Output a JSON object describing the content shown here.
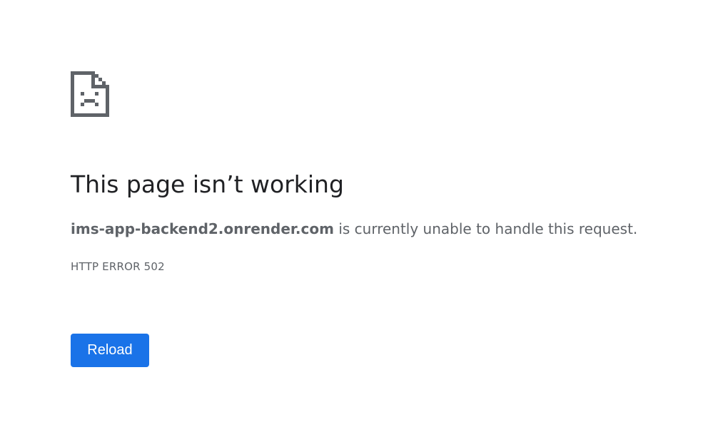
{
  "error_page": {
    "icon": "sad-document-icon",
    "title": "This page isn’t working",
    "host": "ims-app-backend2.onrender.com",
    "summary_rest": " is currently unable to handle this request.",
    "error_code": "HTTP ERROR 502",
    "reload_label": "Reload"
  },
  "colors": {
    "background": "#ffffff",
    "title_text": "#202124",
    "body_text": "#5f6368",
    "icon": "#5f6368",
    "button_background": "#1a73e8",
    "button_text": "#ffffff"
  }
}
